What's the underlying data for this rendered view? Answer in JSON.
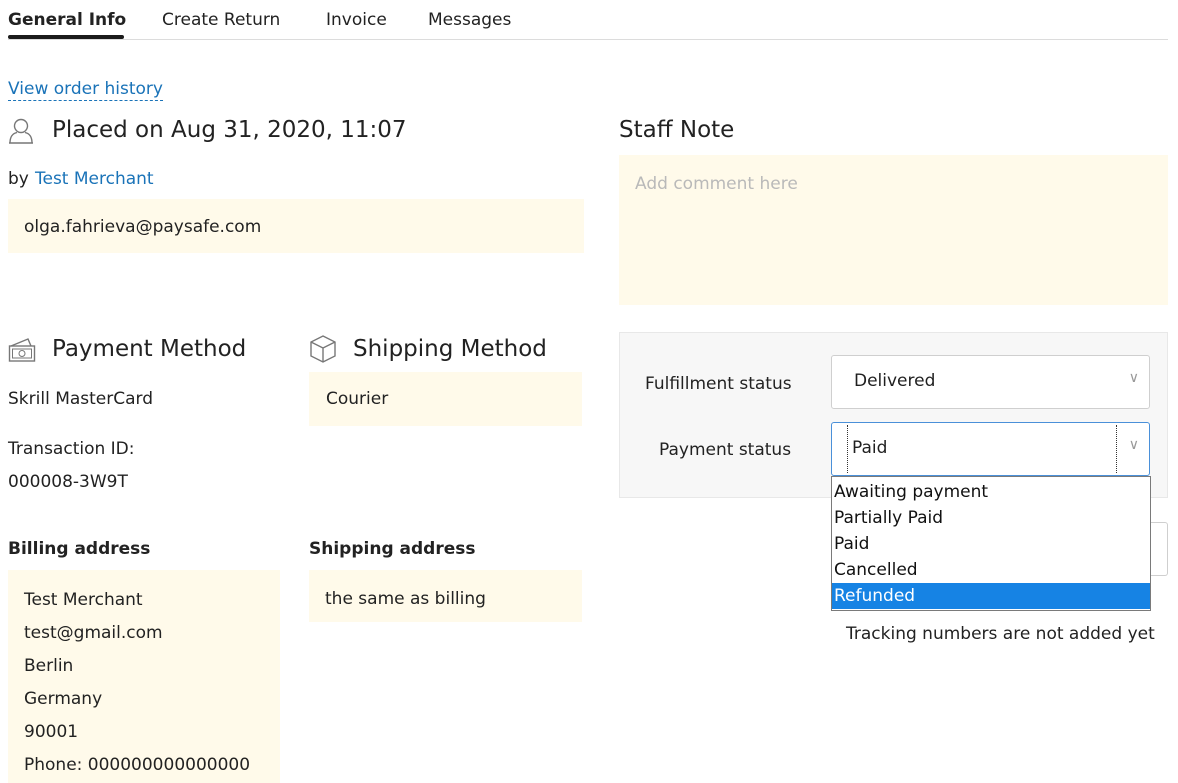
{
  "tabs": [
    {
      "label": "General Info",
      "active": true
    },
    {
      "label": "Create Return",
      "active": false
    },
    {
      "label": "Invoice",
      "active": false
    },
    {
      "label": "Messages",
      "active": false
    }
  ],
  "order": {
    "history_link": "View order history",
    "placed_text": "Placed on Aug 31, 2020, 11:07",
    "by_prefix": "by",
    "merchant_link": "Test Merchant",
    "email": "olga.fahrieva@paysafe.com"
  },
  "staff_note": {
    "title": "Staff Note",
    "placeholder": "Add comment here"
  },
  "payment": {
    "title": "Payment Method",
    "method": "Skrill MasterCard",
    "transaction_label": "Transaction ID:",
    "transaction_id": "000008-3W9T"
  },
  "shipping": {
    "title": "Shipping Method",
    "method": "Courier"
  },
  "billing_address": {
    "title": "Billing address",
    "lines": [
      "Test Merchant",
      "test@gmail.com",
      "Berlin",
      "Germany",
      "90001",
      "Phone: 000000000000000"
    ]
  },
  "shipping_address": {
    "title": "Shipping address",
    "value": "the same as billing"
  },
  "status": {
    "fulfillment_label": "Fulfillment status",
    "fulfillment_value": "Delivered",
    "payment_label": "Payment status",
    "payment_value": "Paid",
    "payment_options": [
      "Awaiting payment",
      "Partially Paid",
      "Paid",
      "Cancelled",
      "Refunded"
    ],
    "highlighted_option": "Refunded"
  },
  "tracking": {
    "empty_text": "Tracking numbers are not added yet"
  },
  "colors": {
    "accent_link": "#1a73b8",
    "note_background": "#fffaea",
    "dropdown_highlight": "#1683e4"
  }
}
